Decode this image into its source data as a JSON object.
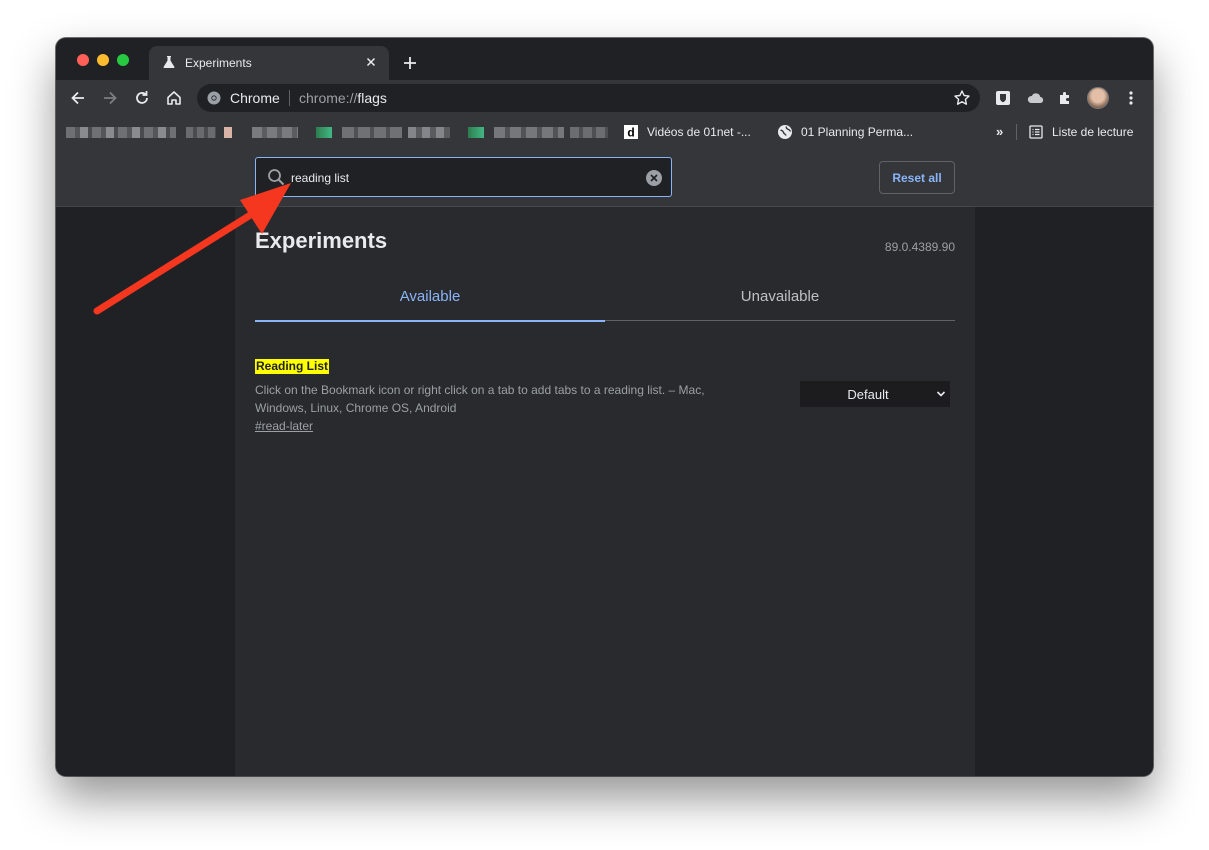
{
  "colors": {
    "window_bg": "#202124",
    "toolbar_bg": "#35363a",
    "accent": "#8ab4f8",
    "highlight": "#ffff00",
    "annotation_arrow": "#f5371f",
    "traffic_close": "#ff5f57",
    "traffic_minimize": "#febc2e",
    "traffic_maximize": "#28c840"
  },
  "tab": {
    "title": "Experiments",
    "icon": "flask-icon",
    "close_icon": "close-icon"
  },
  "new_tab_icon": "plus-icon",
  "toolbar": {
    "back_icon": "arrow-left-icon",
    "forward_icon": "arrow-right-icon",
    "reload_icon": "reload-icon",
    "home_icon": "home-icon",
    "omnibox": {
      "chip_label": "Chrome",
      "url_prefix": "chrome://",
      "url_path": "flags",
      "star_icon": "star-icon"
    },
    "extensions": [
      "bitwarden-shield-icon",
      "cloud-icon",
      "puzzle-piece-icon",
      "avatar",
      "kebab-menu-icon"
    ]
  },
  "bookmarks": {
    "items": [
      {
        "label": "Vidéos de 01net -...",
        "icon": "d-logo-icon"
      },
      {
        "label": "01 Planning Perma...",
        "icon": "globe-icon"
      }
    ],
    "more_label": "»",
    "reading_list_label": "Liste de lecture",
    "reading_list_icon": "reading-list-icon"
  },
  "search": {
    "value": "reading list",
    "search_icon": "magnifier-icon",
    "clear_icon": "clear-circle-icon"
  },
  "reset_button": "Reset all",
  "page": {
    "title": "Experiments",
    "version": "89.0.4389.90"
  },
  "tabs": [
    {
      "label": "Available",
      "selected": true
    },
    {
      "label": "Unavailable",
      "selected": false
    }
  ],
  "experiment": {
    "title": "Reading List",
    "description": "Click on the Bookmark icon or right click on a tab to add tabs to a reading list. – Mac, Windows, Linux, Chrome OS, Android",
    "link": "#read-later",
    "select_value": "Default"
  }
}
